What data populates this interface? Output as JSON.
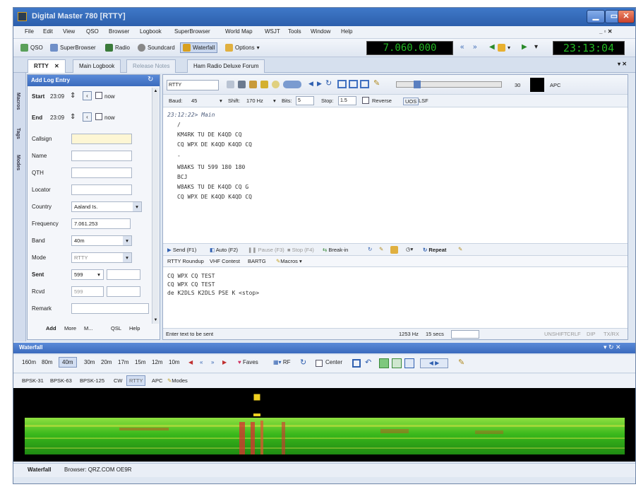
{
  "window": {
    "title": "Digital Master 780 [RTTY]"
  },
  "menu": [
    "File",
    "Edit",
    "View",
    "QSO",
    "Browser",
    "Logbook",
    "SuperBrowser",
    "World Map",
    "WSJT",
    "Tools",
    "Window",
    "Help"
  ],
  "toolbar": {
    "qso": "QSO",
    "superbrowser": "SuperBrowser",
    "radio": "Radio",
    "soundcard": "Soundcard",
    "waterfall": "Waterfall",
    "options": "Options",
    "frequency": "7.060.000",
    "time": "23:13:04"
  },
  "tabs": [
    "RTTY",
    "Main Logbook",
    "Release Notes",
    "Ham Radio Deluxe Forum"
  ],
  "sidebar": {
    "items": [
      "Macros",
      "Tags",
      "Modes"
    ]
  },
  "log": {
    "header": "Add Log Entry",
    "start_label": "Start",
    "start_value": "23:09",
    "start_now": "now",
    "end_label": "End",
    "end_value": "23:09",
    "end_now": "now",
    "labels": [
      "Callsign",
      "Name",
      "QTH",
      "Locator",
      "Country",
      "Frequency",
      "Band",
      "Mode",
      "Sent",
      "Rcvd",
      "Remark"
    ],
    "country": "Aaland Is.",
    "frequency": "7.061.253",
    "band": "40m",
    "mode": "RTTY",
    "sent": "599",
    "rcvd": "599",
    "nav": [
      "Add",
      "More",
      "M...",
      "QSL",
      "Help"
    ]
  },
  "rtty": {
    "mode_select": "RTTY",
    "apc": "APC",
    "level": "30",
    "baud_label": "Baud:",
    "baud": "45",
    "shift_label": "Shift:",
    "shift": "170 Hz",
    "bits_label": "Bits:",
    "bits": "5",
    "stop_label": "Stop:",
    "stop": "1.5",
    "reverse": "Reverse",
    "uos": "UOS",
    "lsf": "LSF",
    "rx_lines": [
      "23:12:22> Main",
      "/",
      "KM4RK TU DE K4QD CQ",
      "CQ WPX DE K4QD K4QD CQ",
      "-",
      "W8AKS TU 599 180 180",
      "BCJ",
      "W8AKS TU DE K4QD CQ G",
      "CQ WPX DE K4QD K4QD CQ"
    ],
    "macros": {
      "send": "Send (F1)",
      "auto": "Auto (F2)",
      "pause": "Pause (F3)",
      "stop": "Stop (F4)",
      "breakin": "Break-in",
      "repeat": "Repeat"
    },
    "contests": {
      "roundup": "RTTY Roundup",
      "vhf": "VHF Contest",
      "bartg": "BARTG",
      "macros": "Macros"
    },
    "tx_lines": [
      "CQ WPX CQ TEST",
      "CQ WPX CQ TEST",
      "de K2DLS K2DLS PSE K <stop>"
    ],
    "status": {
      "prompt": "Enter text to be sent",
      "hz": "1253 Hz",
      "secs": "15 secs",
      "tail": [
        "UNSHIFT",
        "CRLF",
        "DIP",
        "TX/RX"
      ]
    }
  },
  "waterfall": {
    "header": "Waterfall",
    "bands": [
      "160m",
      "80m",
      "40m",
      "30m",
      "20m",
      "17m",
      "15m",
      "12m",
      "10m"
    ],
    "faves": "Faves",
    "rf": "RF",
    "center": "Center",
    "modes": [
      "BPSK-31",
      "BPSK-63",
      "BPSK-125",
      "CW",
      "RTTY",
      "APC",
      "Modes"
    ],
    "bottom_tabs": [
      "Waterfall",
      "Browser: QRZ.COM OE9R"
    ]
  },
  "colors": {
    "titlebar": "#3f78c8",
    "display_bg": "#000000",
    "display_text": "#22b822",
    "wf_green": "#35c21b",
    "wf_red": "#d01818"
  }
}
